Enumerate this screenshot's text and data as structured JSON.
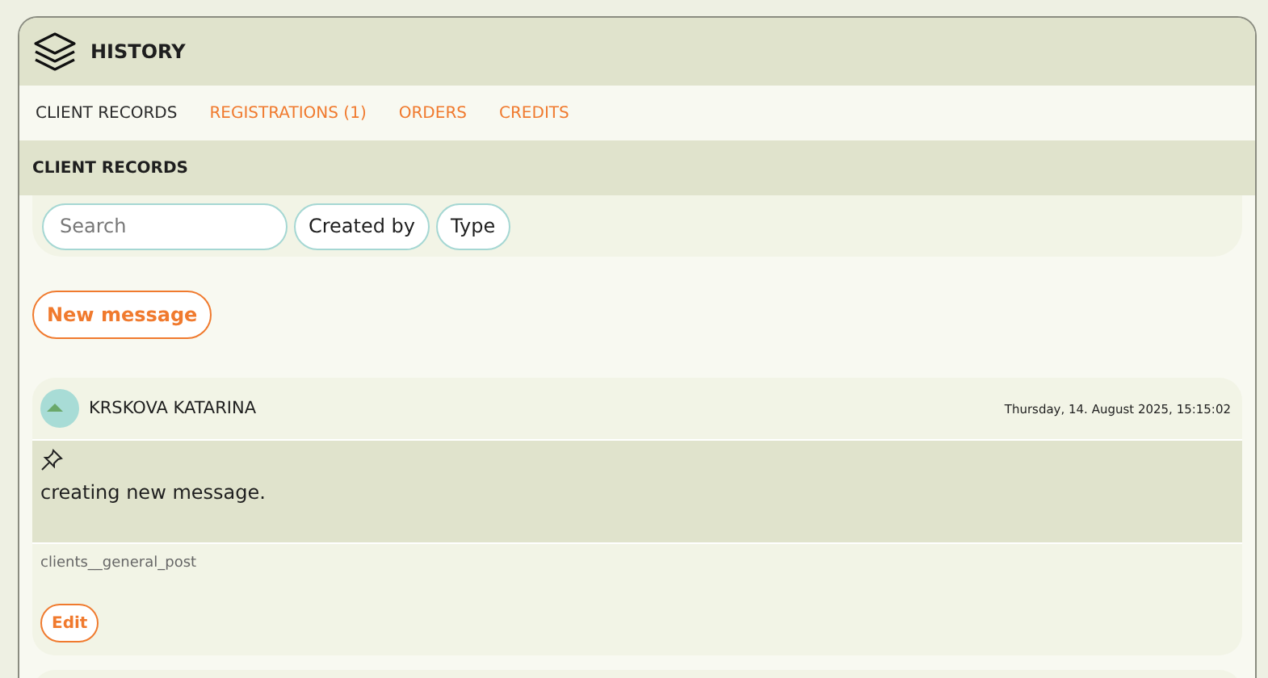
{
  "window": {
    "title": "HISTORY"
  },
  "tabs": [
    {
      "label": "CLIENT RECORDS",
      "selected": true
    },
    {
      "label": "REGISTRATIONS (1)",
      "selected": false
    },
    {
      "label": "ORDERS",
      "selected": false
    },
    {
      "label": "CREDITS",
      "selected": false
    }
  ],
  "section": {
    "title": "CLIENT RECORDS"
  },
  "filters": {
    "search": {
      "placeholder": "Search"
    },
    "buttons": [
      "Created by",
      "Type"
    ]
  },
  "new_message_button": "New message",
  "messages": [
    {
      "author": "KRSKOVA KATARINA",
      "timestamp": "Thursday, 14. August 2025, 15:15:02",
      "pinned": true,
      "body": "creating new message.",
      "category": "clients__general_post",
      "action": "Edit"
    }
  ]
}
